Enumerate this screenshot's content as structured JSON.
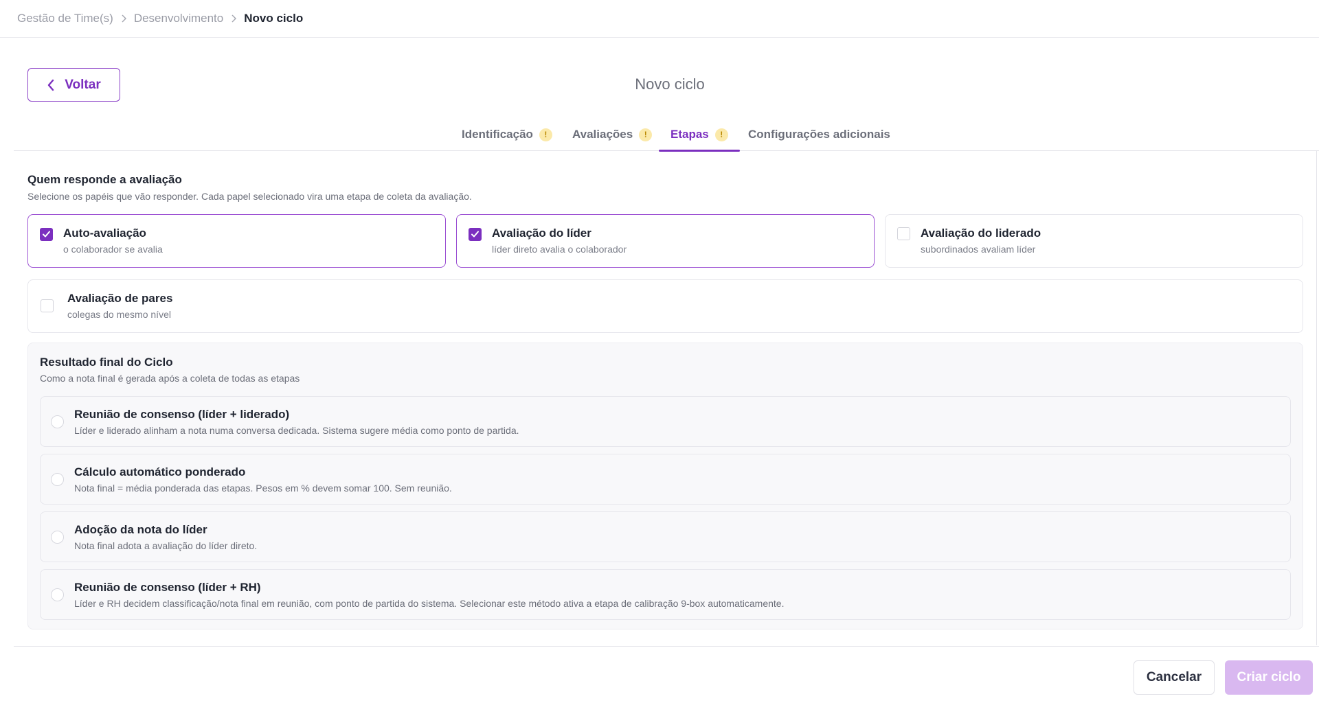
{
  "breadcrumb": {
    "items": [
      "Gestão de Time(s)",
      "Desenvolvimento",
      "Novo ciclo"
    ]
  },
  "header": {
    "back_label": "Voltar",
    "title": "Novo ciclo"
  },
  "tabs": [
    {
      "label": "Identificação",
      "warning": "!",
      "active": false
    },
    {
      "label": "Avaliações",
      "warning": "!",
      "active": false
    },
    {
      "label": "Etapas",
      "warning": "!",
      "active": true
    },
    {
      "label": "Configurações adicionais",
      "active": false
    }
  ],
  "respondents": {
    "title": "Quem responde a avaliação",
    "subtitle": "Selecione os papéis que vão responder. Cada papel selecionado vira uma etapa de coleta da avaliação.",
    "roles": [
      {
        "title": "Auto-avaliação",
        "desc": "o colaborador se avalia",
        "checked": true
      },
      {
        "title": "Avaliação do líder",
        "desc": "líder direto avalia o colaborador",
        "checked": true
      },
      {
        "title": "Avaliação do liderado",
        "desc": "subordinados avaliam líder",
        "checked": false
      },
      {
        "title": "Avaliação de pares",
        "desc": "colegas do mesmo nível",
        "checked": false
      }
    ]
  },
  "result": {
    "title": "Resultado final do Ciclo",
    "subtitle": "Como a nota final é gerada após a coleta de todas as etapas",
    "options": [
      {
        "title": "Reunião de consenso (líder + liderado)",
        "desc": "Líder e liderado alinham a nota numa conversa dedicada. Sistema sugere média como ponto de partida.",
        "selected": false
      },
      {
        "title": "Cálculo automático ponderado",
        "desc": "Nota final = média ponderada das etapas. Pesos em % devem somar 100. Sem reunião.",
        "selected": false
      },
      {
        "title": "Adoção da nota do líder",
        "desc": "Nota final adota a avaliação do líder direto.",
        "selected": false
      },
      {
        "title": "Reunião de consenso (líder + RH)",
        "desc": "Líder e RH decidem classificação/nota final em reunião, com ponto de partida do sistema. Selecionar este método ativa a etapa de calibração 9-box automaticamente.",
        "selected": false
      }
    ]
  },
  "footer": {
    "cancel_label": "Cancelar",
    "create_label": "Criar ciclo"
  },
  "colors": {
    "accent": "#7b2fbf",
    "warning_bg": "#fbe9a9",
    "create_disabled": "#d9b8f0"
  }
}
